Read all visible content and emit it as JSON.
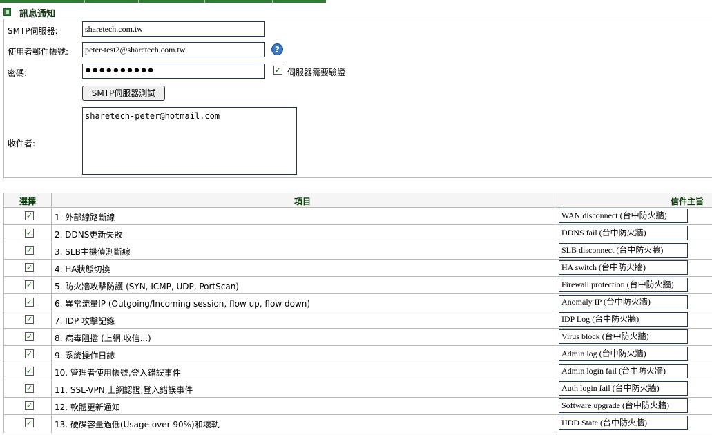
{
  "section": {
    "title": "訊息通知"
  },
  "form": {
    "smtp_label": "SMTP伺服器:",
    "smtp_value": "sharetech.com.tw",
    "account_label": "使用者郵件帳號:",
    "account_value": "peter-test2@sharetech.com.tw",
    "password_label": "密碼:",
    "password_mask": "●●●●●●●●●●",
    "auth_checkbox_checked": true,
    "auth_label": "伺服器需要驗證",
    "test_button": "SMTP伺服器測試",
    "recipients_label": "收件者:",
    "recipients_value": "sharetech-peter@hotmail.com",
    "help_icon": "question-circle-icon"
  },
  "table": {
    "headers": {
      "select": "選擇",
      "item": "項目",
      "subject": "信件主旨"
    },
    "rows": [
      {
        "checked": true,
        "item": "1. 外部線路斷線",
        "subject": "WAN disconnect (台中防火牆)"
      },
      {
        "checked": true,
        "item": "2. DDNS更新失敗",
        "subject": "DDNS fail (台中防火牆)"
      },
      {
        "checked": true,
        "item": "3. SLB主機偵測斷線",
        "subject": "SLB disconnect (台中防火牆)"
      },
      {
        "checked": true,
        "item": "4. HA狀態切換",
        "subject": "HA switch (台中防火牆)"
      },
      {
        "checked": true,
        "item": "5. 防火牆攻擊防護 (SYN, ICMP, UDP, PortScan)",
        "subject": "Firewall protection (台中防火牆)"
      },
      {
        "checked": true,
        "item": "6. 異常流量IP (Outgoing/Incoming session, flow up, flow down)",
        "subject": "Anomaly IP (台中防火牆)"
      },
      {
        "checked": true,
        "item": "7. IDP 攻擊記錄",
        "subject": "IDP Log (台中防火牆)"
      },
      {
        "checked": true,
        "item": "8. 病毒阻擋 (上網,收信...)",
        "subject": "Virus block (台中防火牆)"
      },
      {
        "checked": true,
        "item": "9. 系統操作日誌",
        "subject": "Admin log (台中防火牆)"
      },
      {
        "checked": true,
        "item": "10. 管理者使用帳號,登入錯誤事件",
        "subject": "Admin login fail (台中防火牆)"
      },
      {
        "checked": true,
        "item": "11. SSL-VPN,上網認證,登入錯誤事件",
        "subject": "Auth login fail (台中防火牆)"
      },
      {
        "checked": true,
        "item": "12. 軟體更新通知",
        "subject": "Software upgrade (台中防火牆)"
      },
      {
        "checked": true,
        "item": "13. 硬碟容量過低(Usage over 90%)和壞軌",
        "subject": "HDD State (台中防火牆)"
      }
    ]
  },
  "colors": {
    "accent": "#2e7d32",
    "header_text": "#0b3d0b",
    "border": "#b9b9b9"
  }
}
